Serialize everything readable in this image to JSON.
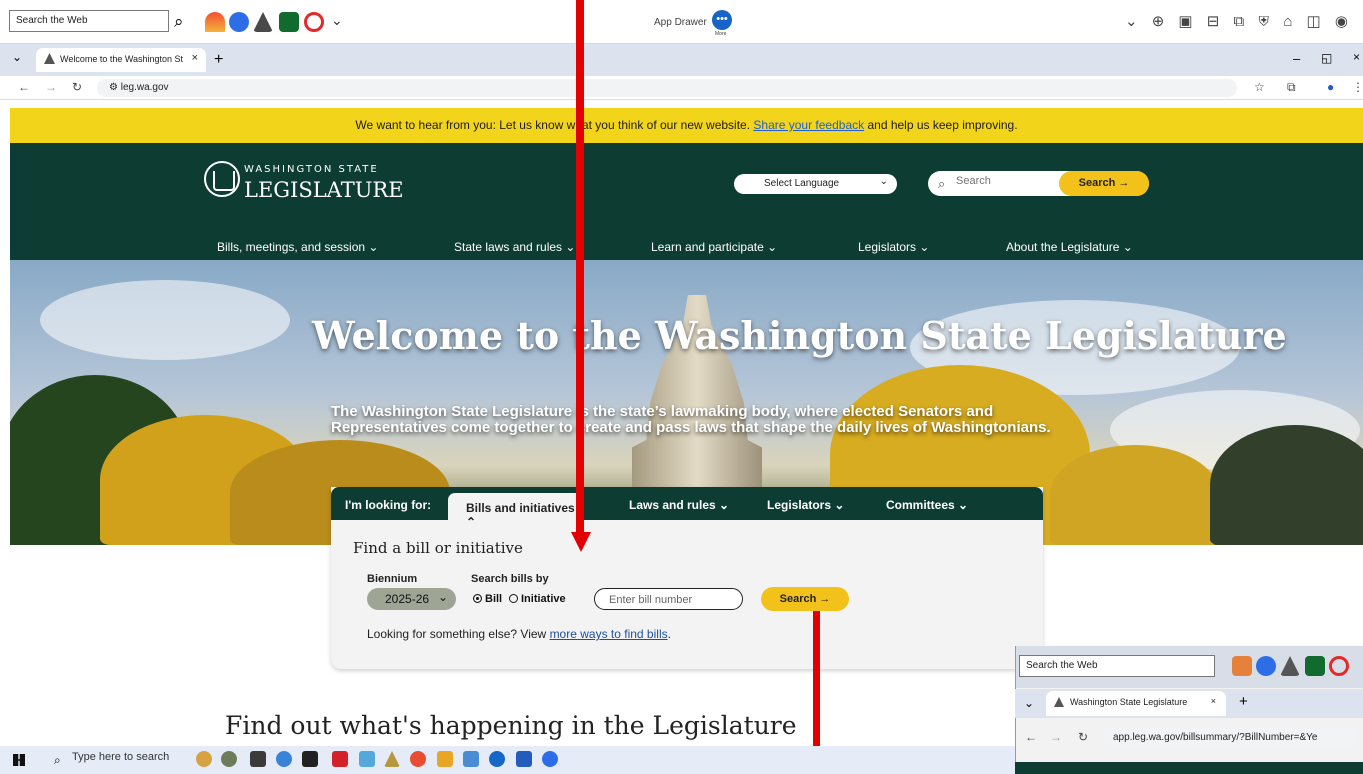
{
  "desktop": {
    "search_placeholder": "Search the Web",
    "app_drawer": "App Drawer",
    "app_drawer_sub": "More",
    "taskbar_search": "Type here to search"
  },
  "browser": {
    "tab_title": "Welcome to the Washington St",
    "url": "leg.wa.gov",
    "preview_tab_title": "Washington State Legislature",
    "preview_url": "app.leg.wa.gov/billsummary/?BillNumber=&Ye"
  },
  "feedback": {
    "text": "We want to hear from you: Let us know what you think of our new website. ",
    "link": "Share your feedback",
    "tail": " and help us keep improving."
  },
  "header": {
    "brand_top": "WASHINGTON STATE",
    "brand_main": "LEGISLATURE",
    "language": "Select Language",
    "search_placeholder": "Search",
    "search_button": "Search →"
  },
  "nav": [
    "Bills, meetings, and session",
    "State laws and rules",
    "Learn and participate",
    "Legislators",
    "About the Legislature"
  ],
  "hero": {
    "title": "Welcome to the Washington State Legislature",
    "description": "The Washington State Legislature is the state’s lawmaking body, where elected Senators and Representatives come together to create and pass laws that shape the daily lives of Washingtonians."
  },
  "finder": {
    "looking_for": "I'm looking for:",
    "tabs": [
      "Bills and initiatives",
      "Laws and rules",
      "Legislators",
      "Committees"
    ],
    "title": "Find a bill or initiative",
    "biennium_label": "Biennium",
    "biennium_value": "2025-26",
    "search_by_label": "Search bills by",
    "option_bill": "Bill",
    "option_initiative": "Initiative",
    "bill_placeholder": "Enter bill number",
    "search_button": "Search →",
    "other_prefix": "Looking for something else? View ",
    "other_link": "more ways to find bills",
    "other_suffix": "."
  },
  "section": {
    "title": "Find out what's happening in the Legislature"
  },
  "icons": [
    "search-icon",
    "chevron-down-icon",
    "close-icon",
    "plus-icon",
    "back-icon",
    "forward-icon",
    "reload-icon",
    "star-icon",
    "extensions-icon",
    "profile-icon",
    "windows-icon",
    "capitol-logo-icon",
    "arrow-right-icon"
  ],
  "colors": {
    "accent": "#f2c21b",
    "header": "#0d3d32",
    "arrow": "#e30000"
  }
}
